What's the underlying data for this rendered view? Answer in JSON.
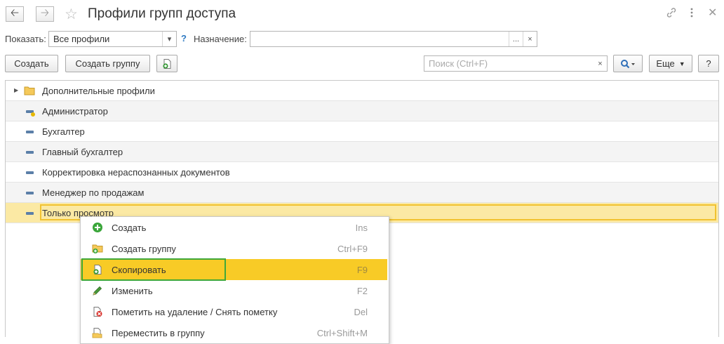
{
  "window": {
    "title": "Профили групп доступа",
    "back_icon": "arrow-left",
    "forward_icon": "arrow-right",
    "favorite_icon": "star-outline",
    "link_icon": "link",
    "more_icon": "vertical-dots",
    "close_icon": "cross"
  },
  "filters": {
    "show_label": "Показать:",
    "show_value": "Все профили",
    "dropdown_icon": "triangle-down",
    "help_mark": "?",
    "purpose_label": "Назначение:",
    "purpose_value": "",
    "ellipsis_label": "...",
    "clear_label": "×"
  },
  "toolbar": {
    "create_label": "Создать",
    "create_group_label": "Создать группу",
    "copy_icon": "copy-doc-plus",
    "search_placeholder": "Поиск (Ctrl+F)",
    "search_clear_label": "×",
    "search_icon": "magnifier",
    "more_label": "Еще",
    "help_label": "?"
  },
  "list": {
    "rows": [
      {
        "label": "Дополнительные профили",
        "icon": "folder",
        "expandable": true
      },
      {
        "label": "Администратор",
        "icon": "profile-marked"
      },
      {
        "label": "Бухгалтер",
        "icon": "profile"
      },
      {
        "label": "Главный бухгалтер",
        "icon": "profile"
      },
      {
        "label": "Корректировка нераспознанных документов",
        "icon": "profile"
      },
      {
        "label": "Менеджер по продажам",
        "icon": "profile"
      },
      {
        "label": "Только просмотр",
        "icon": "profile",
        "selected": true
      }
    ]
  },
  "context_menu": {
    "items": [
      {
        "label": "Создать",
        "shortcut": "Ins",
        "icon": "plus-circle"
      },
      {
        "label": "Создать группу",
        "shortcut": "Ctrl+F9",
        "icon": "folder-plus"
      },
      {
        "label": "Скопировать",
        "shortcut": "F9",
        "icon": "copy-doc-plus",
        "active": true
      },
      {
        "label": "Изменить",
        "shortcut": "F2",
        "icon": "pencil"
      },
      {
        "label": "Пометить на удаление / Снять пометку",
        "shortcut": "Del",
        "icon": "delete-mark"
      },
      {
        "label": "Переместить в группу",
        "shortcut": "Ctrl+Shift+M",
        "icon": "move-to-folder"
      }
    ]
  },
  "colors": {
    "selected_row": "#fbe9a4",
    "menu_active": "#f8cb26",
    "highlight_frame": "#3fa83a"
  }
}
